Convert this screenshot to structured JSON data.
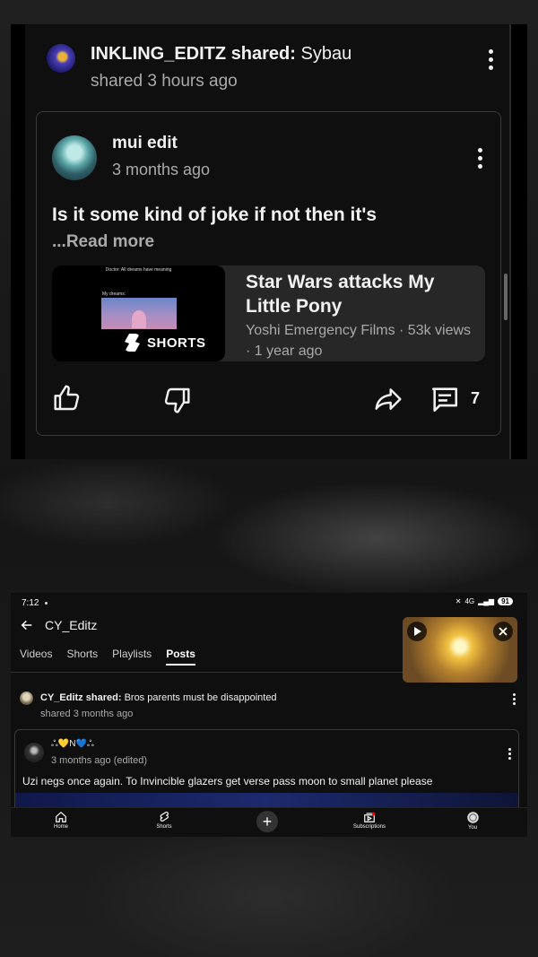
{
  "top_post": {
    "sharer_name": "INKLING_EDITZ",
    "shared_word": "shared:",
    "shared_text": "Sybau",
    "shared_time": "shared 3 hours ago",
    "card": {
      "author": "mui edit",
      "time": "3 months ago",
      "body": "Is it some kind of joke if not then it's",
      "read_more": "...Read more",
      "video": {
        "thumb_caption_top": "Doctor: All dreams have meaning",
        "thumb_caption_mid": "My dreams:",
        "badge": "SHORTS",
        "title": "Star Wars attacks My Little Pony",
        "meta": "Yoshi Emergency Films · 53k views · 1 year ago"
      },
      "comment_count": "7"
    }
  },
  "phone": {
    "status": {
      "time": "7:12",
      "network": "4G",
      "battery": "91"
    },
    "channel_name": "CY_Editz",
    "tabs": [
      {
        "label": "Videos"
      },
      {
        "label": "Shorts"
      },
      {
        "label": "Playlists"
      },
      {
        "label": "Posts"
      }
    ],
    "post": {
      "sharer_name": "CY_Editz",
      "shared_word": "shared:",
      "shared_text": "Bros parents must be disappointed",
      "shared_time": "shared 3 months ago",
      "card": {
        "author": "ஃ💛N💙ஃ",
        "time": "3 months ago (edited)",
        "body": "Uzi negs once again. To Invincible glazers get verse pass moon to small planet please"
      }
    },
    "nav": {
      "home": "Home",
      "shorts": "Shorts",
      "subscriptions": "Subscriptions",
      "you": "You"
    }
  }
}
